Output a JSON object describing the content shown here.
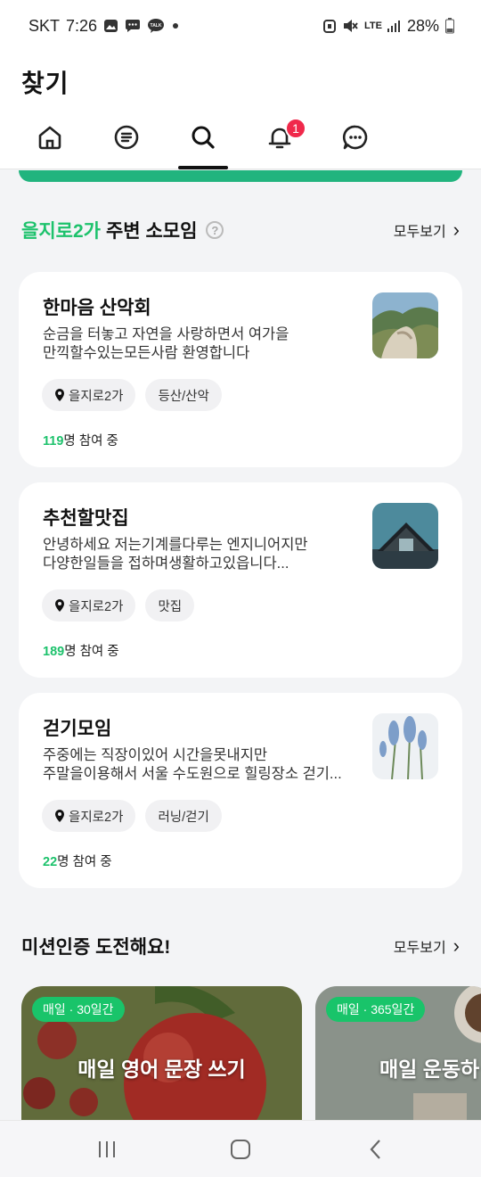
{
  "status_bar": {
    "carrier": "SKT",
    "time": "7:26",
    "network": "LTE",
    "battery": "28%"
  },
  "header": {
    "title": "찾기"
  },
  "tabs": [
    {
      "name": "home",
      "icon": "home-icon"
    },
    {
      "name": "feed",
      "icon": "list-icon"
    },
    {
      "name": "search",
      "icon": "search-icon",
      "active": true
    },
    {
      "name": "notifications",
      "icon": "bell-icon",
      "badge": "1"
    },
    {
      "name": "chat",
      "icon": "chat-icon"
    },
    {
      "name": "profile",
      "icon": "avatar"
    }
  ],
  "nearby": {
    "location": "을지로2가",
    "title_suffix": "주변 소모임",
    "help": "?",
    "see_all": "모두보기",
    "groups": [
      {
        "name": "한마음 산악회",
        "desc1": "순금을 터놓고 자연을 사랑하면서 여가을",
        "desc2": "만끽할수있는모든사람 환영합니다",
        "location_tag": "을지로2가",
        "category": "등산/산악",
        "count": "119",
        "count_suffix": "명 참여 중",
        "thumb": "mountain-photo"
      },
      {
        "name": "추천할맛집",
        "desc1": "안녕하세요  저는기계를다루는 엔지니어지만",
        "desc2": "다양한일들을 접하며생활하고있읍니다...",
        "location_tag": "을지로2가",
        "category": "맛집",
        "count": "189",
        "count_suffix": "명 참여 중",
        "thumb": "house-photo"
      },
      {
        "name": "걷기모임",
        "desc1": "주중에는 직장이있어  시간을못내지만",
        "desc2": "주말을이용해서 서울 수도원으로 힐링장소 걷기...",
        "location_tag": "을지로2가",
        "category": "러닝/걷기",
        "count": "22",
        "count_suffix": "명 참여 중",
        "thumb": "flower-photo"
      }
    ]
  },
  "missions": {
    "title": "미션인증 도전해요!",
    "see_all": "모두보기",
    "items": [
      {
        "badge": "매일 · 30일간",
        "title": "매일 영어 문장 쓰기",
        "image": "apple-photo"
      },
      {
        "badge": "매일 · 365일간",
        "title": "매일 운동하",
        "image": "desk-photo"
      }
    ]
  },
  "colors": {
    "accent": "#1dc26c",
    "banner": "#21b47e",
    "badge_red": "#f0294b"
  }
}
